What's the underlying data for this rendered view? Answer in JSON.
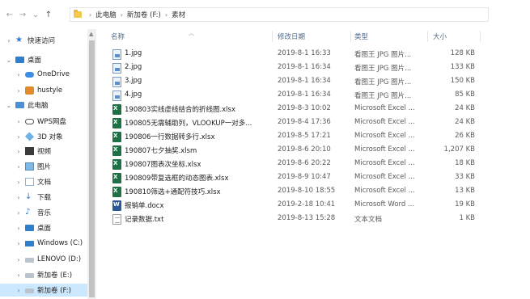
{
  "breadcrumb": [
    "此电脑",
    "新加卷 (F:)",
    "素材"
  ],
  "columns": {
    "name": "名称",
    "date": "修改日期",
    "type": "类型",
    "size": "大小"
  },
  "nav_items": [
    {
      "label": "快速访问",
      "icon": "star-icon",
      "chevron": "›"
    },
    {
      "label": "桌面",
      "icon": "desktop-icon",
      "chevron": "⌄"
    },
    {
      "label": "OneDrive",
      "icon": "onedrive-icon",
      "chevron": "›"
    },
    {
      "label": "hustyle",
      "icon": "user-icon",
      "chevron": "›"
    },
    {
      "label": "此电脑",
      "icon": "this-pc-icon",
      "chevron": "⌄"
    },
    {
      "label": "WPS网盘",
      "icon": "wps-cloud-icon",
      "chevron": "›"
    },
    {
      "label": "3D 对象",
      "icon": "3d-objects-icon",
      "chevron": "›"
    },
    {
      "label": "视频",
      "icon": "video-icon",
      "chevron": "›"
    },
    {
      "label": "图片",
      "icon": "pictures-icon",
      "chevron": "›"
    },
    {
      "label": "文档",
      "icon": "documents-icon",
      "chevron": "›"
    },
    {
      "label": "下载",
      "icon": "downloads-icon",
      "chevron": "›"
    },
    {
      "label": "音乐",
      "icon": "music-icon",
      "chevron": "›"
    },
    {
      "label": "桌面",
      "icon": "desktop-icon",
      "chevron": "›"
    },
    {
      "label": "Windows (C:)",
      "icon": "windows-drive-icon",
      "chevron": "›"
    },
    {
      "label": "LENOVO (D:)",
      "icon": "drive-icon",
      "chevron": "›"
    },
    {
      "label": "新加卷 (E:)",
      "icon": "drive-icon",
      "chevron": "›"
    },
    {
      "label": "新加卷 (F:)",
      "icon": "drive-icon",
      "chevron": "›",
      "selected": true
    }
  ],
  "files": [
    {
      "name": "1.jpg",
      "date": "2019-8-1 16:33",
      "type": "看图王 JPG 图片...",
      "size": "128 KB",
      "icon": "jpg-file-icon"
    },
    {
      "name": "2.jpg",
      "date": "2019-8-1 16:34",
      "type": "看图王 JPG 图片...",
      "size": "133 KB",
      "icon": "jpg-file-icon"
    },
    {
      "name": "3.jpg",
      "date": "2019-8-1 16:34",
      "type": "看图王 JPG 图片...",
      "size": "150 KB",
      "icon": "jpg-file-icon"
    },
    {
      "name": "4.jpg",
      "date": "2019-8-1 16:34",
      "type": "看图王 JPG 图片...",
      "size": "85 KB",
      "icon": "jpg-file-icon"
    },
    {
      "name": "190803实线虚线结合的折线图.xlsx",
      "date": "2019-8-3 10:02",
      "type": "Microsoft Excel ...",
      "size": "24 KB",
      "icon": "excel-file-icon"
    },
    {
      "name": "190805无需辅助列，VLOOKUP一对多...",
      "date": "2019-8-4 17:36",
      "type": "Microsoft Excel ...",
      "size": "24 KB",
      "icon": "excel-file-icon"
    },
    {
      "name": "190806一行数据转多行.xlsx",
      "date": "2019-8-5 17:21",
      "type": "Microsoft Excel ...",
      "size": "26 KB",
      "icon": "excel-file-icon"
    },
    {
      "name": "190807七夕抽奖.xlsm",
      "date": "2019-8-6 20:10",
      "type": "Microsoft Excel ...",
      "size": "1,207 KB",
      "icon": "excel-file-icon"
    },
    {
      "name": "190807图表次坐标.xlsx",
      "date": "2019-8-6 20:22",
      "type": "Microsoft Excel ...",
      "size": "18 KB",
      "icon": "excel-file-icon"
    },
    {
      "name": "190809带复选框的动态图表.xlsx",
      "date": "2019-8-9 10:47",
      "type": "Microsoft Excel ...",
      "size": "33 KB",
      "icon": "excel-file-icon"
    },
    {
      "name": "190810筛选+通配符技巧.xlsx",
      "date": "2019-8-10 18:55",
      "type": "Microsoft Excel ...",
      "size": "13 KB",
      "icon": "excel-file-icon"
    },
    {
      "name": "报销单.docx",
      "date": "2019-2-18 10:41",
      "type": "Microsoft Word ...",
      "size": "19 KB",
      "icon": "word-file-icon"
    },
    {
      "name": "记录数据.txt",
      "date": "2019-8-13 15:28",
      "type": "文本文档",
      "size": "1 KB",
      "icon": "text-file-icon"
    }
  ]
}
